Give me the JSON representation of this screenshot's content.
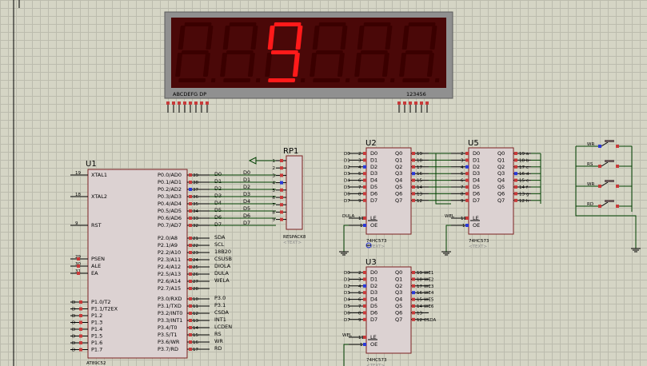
{
  "display": {
    "segment_letters": "ABCDEFG DP",
    "digit_numbers": "123456",
    "shown_digit": "9",
    "digit_color": "#ff1a1a",
    "dim_color": "#3a0000",
    "bg_color": "#4a0808",
    "frame_color": "#909090"
  },
  "u1": {
    "ref": "U1",
    "part": "AT89C52",
    "left_pins": [
      {
        "num": "19",
        "name": "XTAL1"
      },
      {
        "num": "18",
        "name": "XTAL2"
      },
      {
        "num": "9",
        "name": "RST"
      },
      {
        "num": "29",
        "name": "PSEN"
      },
      {
        "num": "30",
        "name": "ALE"
      },
      {
        "num": "31",
        "name": "EA"
      }
    ],
    "p1_pins": [
      {
        "num": "1",
        "name": "P1.0/T2",
        "net": "D"
      },
      {
        "num": "2",
        "name": "P1.1/T2EX",
        "net": "D"
      },
      {
        "num": "3",
        "name": "P1.2",
        "net": "D"
      },
      {
        "num": "4",
        "name": "P1.3",
        "net": "D"
      },
      {
        "num": "5",
        "name": "P1.4",
        "net": "D"
      },
      {
        "num": "6",
        "name": "P1.5",
        "net": "D"
      },
      {
        "num": "7",
        "name": "P1.6",
        "net": "D"
      },
      {
        "num": "8",
        "name": "P1.7",
        "net": "D"
      }
    ],
    "p0_pins": [
      {
        "num": "39",
        "name": "P0.0/AD0",
        "net": "D0"
      },
      {
        "num": "38",
        "name": "P0.1/AD1",
        "net": "D1"
      },
      {
        "num": "37",
        "name": "P0.2/AD2",
        "net": "D2"
      },
      {
        "num": "36",
        "name": "P0.3/AD3",
        "net": "D3"
      },
      {
        "num": "35",
        "name": "P0.4/AD4",
        "net": "D4"
      },
      {
        "num": "34",
        "name": "P0.5/AD5",
        "net": "D5"
      },
      {
        "num": "33",
        "name": "P0.6/AD6",
        "net": "D6"
      },
      {
        "num": "32",
        "name": "P0.7/AD7",
        "net": "D7"
      }
    ],
    "p2_pins": [
      {
        "num": "21",
        "name": "P2.0/A8",
        "net": "SDA"
      },
      {
        "num": "22",
        "name": "P2.1/A9",
        "net": "SCL"
      },
      {
        "num": "23",
        "name": "P2.2/A10",
        "net": "18B20"
      },
      {
        "num": "24",
        "name": "P2.3/A11",
        "net": "CSUSB"
      },
      {
        "num": "25",
        "name": "P2.4/A12",
        "net": "DIOLA"
      },
      {
        "num": "26",
        "name": "P2.5/A13",
        "net": "DULA"
      },
      {
        "num": "27",
        "name": "P2.6/A14",
        "net": "WELA"
      },
      {
        "num": "28",
        "name": "P2.7/A15",
        "net": ""
      }
    ],
    "p3_pins": [
      {
        "num": "10",
        "name": "P3.0/RXD",
        "net": "P3.0"
      },
      {
        "num": "11",
        "name": "P3.1/TXD",
        "net": "P3.1"
      },
      {
        "num": "12",
        "name": "P3.2/INT0",
        "net": "CSDA"
      },
      {
        "num": "13",
        "name": "P3.3/INT1",
        "net": "INT1"
      },
      {
        "num": "14",
        "name": "P3.4/T0",
        "net": "LCDEN"
      },
      {
        "num": "15",
        "name": "P3.5/T1",
        "net": "RS"
      },
      {
        "num": "16",
        "name": "P3.6/WR",
        "net": "WR"
      },
      {
        "num": "17",
        "name": "P3.7/RD",
        "net": "RD"
      }
    ]
  },
  "rp1": {
    "ref": "RP1",
    "part": "RESPACK8",
    "text": "<TEXT>",
    "pins": [
      "1",
      "2",
      "3",
      "4",
      "5",
      "6",
      "7",
      "8",
      "9"
    ]
  },
  "u2": {
    "ref": "U2",
    "part": "74HC573",
    "text": "<TEXT>",
    "d_pins": [
      {
        "num": "2",
        "name": "D0",
        "net": "D0"
      },
      {
        "num": "3",
        "name": "D1",
        "net": "D1"
      },
      {
        "num": "4",
        "name": "D2",
        "net": "D2"
      },
      {
        "num": "5",
        "name": "D3",
        "net": "D3"
      },
      {
        "num": "6",
        "name": "D4",
        "net": "D4"
      },
      {
        "num": "7",
        "name": "D5",
        "net": "D5"
      },
      {
        "num": "8",
        "name": "D6",
        "net": "D6"
      },
      {
        "num": "9",
        "name": "D7",
        "net": "D7"
      }
    ],
    "q_pins": [
      {
        "num": "19",
        "name": "Q0"
      },
      {
        "num": "18",
        "name": "Q1"
      },
      {
        "num": "17",
        "name": "Q2"
      },
      {
        "num": "16",
        "name": "Q3"
      },
      {
        "num": "15",
        "name": "Q4"
      },
      {
        "num": "14",
        "name": "Q5"
      },
      {
        "num": "13",
        "name": "Q6"
      },
      {
        "num": "12",
        "name": "Q7"
      }
    ],
    "le": {
      "num": "11",
      "name": "LE",
      "net": "DULA"
    },
    "oe": {
      "num": "1",
      "name": "OE"
    }
  },
  "u5": {
    "ref": "U5",
    "part": "74HC573",
    "text": "<TEXT>",
    "d_pins": [
      {
        "num": "2",
        "name": "D0"
      },
      {
        "num": "3",
        "name": "D1"
      },
      {
        "num": "4",
        "name": "D2"
      },
      {
        "num": "5",
        "name": "D3"
      },
      {
        "num": "6",
        "name": "D4"
      },
      {
        "num": "7",
        "name": "D5"
      },
      {
        "num": "8",
        "name": "D6"
      },
      {
        "num": "9",
        "name": "D7"
      }
    ],
    "q_pins": [
      {
        "num": "19",
        "name": "Q0",
        "net": "a"
      },
      {
        "num": "18",
        "name": "Q1",
        "net": "b"
      },
      {
        "num": "17",
        "name": "Q2",
        "net": "c"
      },
      {
        "num": "16",
        "name": "Q3",
        "net": "d"
      },
      {
        "num": "15",
        "name": "Q4",
        "net": "e"
      },
      {
        "num": "14",
        "name": "Q5",
        "net": "f"
      },
      {
        "num": "13",
        "name": "Q6",
        "net": "g"
      },
      {
        "num": "12",
        "name": "Q7",
        "net": "h"
      }
    ],
    "le": {
      "num": "11",
      "name": "LE",
      "net": "WEL"
    },
    "oe": {
      "num": "1",
      "name": "OE"
    }
  },
  "u3": {
    "ref": "U3",
    "part": "74HC573",
    "text": "<TEXT>",
    "d_pins": [
      {
        "num": "2",
        "name": "D0",
        "net": "D0"
      },
      {
        "num": "3",
        "name": "D1",
        "net": "D1"
      },
      {
        "num": "4",
        "name": "D2",
        "net": "D2"
      },
      {
        "num": "5",
        "name": "D3",
        "net": "D3"
      },
      {
        "num": "6",
        "name": "D4",
        "net": "D4"
      },
      {
        "num": "7",
        "name": "D5",
        "net": "D5"
      },
      {
        "num": "8",
        "name": "D6",
        "net": "D6"
      },
      {
        "num": "9",
        "name": "D7",
        "net": "D7"
      }
    ],
    "q_pins": [
      {
        "num": "19",
        "name": "Q0",
        "net": "WE1"
      },
      {
        "num": "18",
        "name": "Q1",
        "net": "WE2"
      },
      {
        "num": "17",
        "name": "Q2",
        "net": "WE3"
      },
      {
        "num": "16",
        "name": "Q3",
        "net": "WE4"
      },
      {
        "num": "15",
        "name": "Q4",
        "net": "WE5"
      },
      {
        "num": "14",
        "name": "Q5",
        "net": "WE6"
      },
      {
        "num": "13",
        "name": "Q6",
        "net": ""
      },
      {
        "num": "12",
        "name": "Q7",
        "net": "CSDA"
      }
    ],
    "le": {
      "num": "11",
      "name": "LE",
      "net": "WEL"
    },
    "oe": {
      "num": "1",
      "name": "OE"
    }
  },
  "switches": [
    {
      "label": "WR"
    },
    {
      "label": "RS"
    },
    {
      "label": "WR"
    },
    {
      "label": "RD"
    }
  ]
}
